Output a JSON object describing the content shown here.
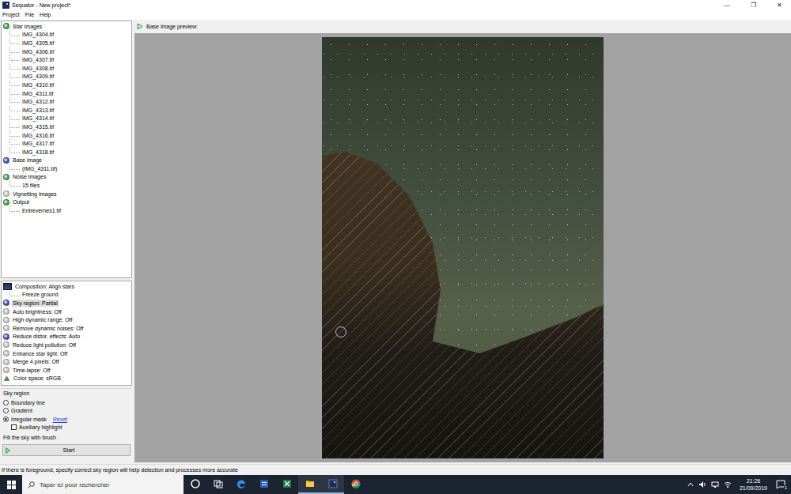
{
  "window": {
    "title": "Sequator - New project*",
    "controls": [
      "—",
      "❐",
      "✕"
    ]
  },
  "menu": [
    "Project",
    "File",
    "Help"
  ],
  "tree": [
    {
      "label": "Star images",
      "color": "#3aa34a",
      "children": [
        "IMG_4304.tif",
        "IMG_4305.tif",
        "IMG_4306.tif",
        "IMG_4307.tif",
        "IMG_4308.tif",
        "IMG_4309.tif",
        "IMG_4310.tif",
        "IMG_4311.tif",
        "IMG_4312.tif",
        "IMG_4313.tif",
        "IMG_4314.tif",
        "IMG_4315.tif",
        "IMG_4316.tif",
        "IMG_4317.tif",
        "IMG_4318.tif"
      ]
    },
    {
      "label": "Base image",
      "color": "#3b4fb8",
      "children": [
        "(IMG_4311.tif)"
      ]
    },
    {
      "label": "Noise images",
      "color": "#3aa34a",
      "children": [
        "15 files"
      ]
    },
    {
      "label": "Vignetting images",
      "color": "#c4c4c4",
      "children": []
    },
    {
      "label": "Output",
      "color": "#3aa34a",
      "children": [
        "Entrevernes1.tif"
      ]
    }
  ],
  "settings": [
    {
      "label": "Composition: Align stars",
      "kind": "composition",
      "color": "#1f2a5a",
      "selected": false,
      "children": [
        "Freeze ground"
      ]
    },
    {
      "label": "Sky region: Partial",
      "kind": "dot",
      "color": "#3b4fb8",
      "selected": true,
      "children": []
    },
    {
      "label": "Auto brightness: Off",
      "kind": "dot",
      "color": "#c4c4c4",
      "selected": false,
      "children": []
    },
    {
      "label": "High dynamic range: Off",
      "kind": "dot",
      "color": "#c4c4c4",
      "selected": false,
      "children": []
    },
    {
      "label": "Remove dynamic noises: Off",
      "kind": "dot",
      "color": "#c4c4c4",
      "selected": false,
      "children": []
    },
    {
      "label": "Reduce distor. effects: Auto",
      "kind": "dot",
      "color": "#3b4fb8",
      "selected": false,
      "children": []
    },
    {
      "label": "Reduce light pollution: Off",
      "kind": "dot",
      "color": "#c4c4c4",
      "selected": false,
      "children": []
    },
    {
      "label": "Enhance star light: Off",
      "kind": "dot",
      "color": "#c4c4c4",
      "selected": false,
      "children": []
    },
    {
      "label": "Merge 4 pixels: Off",
      "kind": "dot",
      "color": "#c4c4c4",
      "selected": false,
      "children": []
    },
    {
      "label": "Time-lapse: Off",
      "kind": "dot",
      "color": "#c4c4c4",
      "selected": false,
      "children": []
    },
    {
      "label": "Color space: sRGB",
      "kind": "colorspace",
      "color": "#3aa34a",
      "selected": false,
      "children": []
    }
  ],
  "sky_region": {
    "title": "Sky region",
    "options": [
      {
        "label": "Boundary line",
        "selected": false,
        "link": ""
      },
      {
        "label": "Gradient",
        "selected": false,
        "link": ""
      },
      {
        "label": "Irregular mask",
        "selected": true,
        "link": "Reset"
      }
    ],
    "checkbox": {
      "label": "Auxiliary highlight",
      "checked": false
    },
    "hint": "Fill the sky with brush"
  },
  "start_button": "Start",
  "preview": {
    "title": "Base image preview:"
  },
  "status_bar": "If there is foreground, specify correct sky region will help detection and processes more accurate",
  "taskbar": {
    "search": {
      "placeholder": "Taper ici pour rechercher"
    },
    "apps": [
      {
        "kind": "cortana",
        "running": false
      },
      {
        "kind": "taskview",
        "running": false
      },
      {
        "kind": "edge",
        "running": false
      },
      {
        "kind": "word",
        "running": false
      },
      {
        "kind": "excel",
        "running": false
      },
      {
        "kind": "explorer",
        "running": true
      },
      {
        "kind": "sequator",
        "running": true
      },
      {
        "kind": "chrome",
        "running": false
      }
    ],
    "time": "21:26",
    "date": "21/09/2019",
    "notifications": "1"
  }
}
